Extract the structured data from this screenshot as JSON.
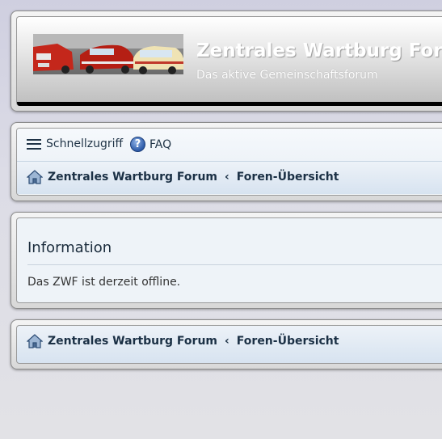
{
  "header": {
    "site_title": "Zentrales Wartburg Forum",
    "site_description": "Das aktive Gemeinschaftsforum",
    "logo_alt": "Wartburg cars"
  },
  "nav": {
    "quick_access": "Schnellzugriff",
    "faq": "FAQ",
    "breadcrumb": {
      "home": "Zentrales Wartburg Forum",
      "separator": "‹",
      "current": "Foren-Übersicht"
    }
  },
  "info": {
    "title": "Information",
    "message": "Das ZWF ist derzeit offline."
  },
  "footer_nav": {
    "breadcrumb": {
      "home": "Zentrales Wartburg Forum",
      "separator": "‹",
      "current": "Foren-Übersicht"
    }
  },
  "colors": {
    "link": "#1b3045",
    "breadcrumb_bg": "#dde7f2",
    "header_bar": "#000000"
  }
}
